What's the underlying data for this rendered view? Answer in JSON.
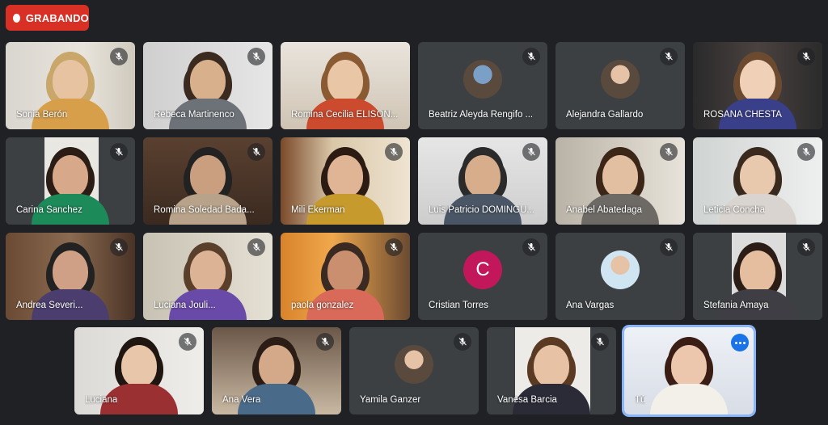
{
  "recording": {
    "label": "GRABANDO"
  },
  "colors": {
    "background": "#202124",
    "tile": "#3c4043",
    "record": "#d93025",
    "self_border": "#8ab4f8",
    "avatar_c": "#c2185b"
  },
  "participants": [
    {
      "name": "Sonia Berón",
      "type": "video",
      "muted": true
    },
    {
      "name": "Rebeca Martinenco",
      "type": "video",
      "muted": true
    },
    {
      "name": "Romina Cecilia ELISON...",
      "type": "video",
      "muted": false
    },
    {
      "name": "Beatriz Aleyda Rengifo ...",
      "type": "avatar",
      "muted": true
    },
    {
      "name": "Alejandra Gallardo",
      "type": "avatar",
      "muted": true
    },
    {
      "name": "ROSANA CHESTA",
      "type": "video",
      "muted": true
    },
    {
      "name": "Carina Sanchez",
      "type": "video",
      "muted": true
    },
    {
      "name": "Romina Soledad Bada...",
      "type": "video",
      "muted": true
    },
    {
      "name": "Mili Ekerman",
      "type": "video",
      "muted": true
    },
    {
      "name": "Luis Patricio DOMINGU...",
      "type": "video",
      "muted": true
    },
    {
      "name": "Anabel Abatedaga",
      "type": "video",
      "muted": true
    },
    {
      "name": "Leticia Concha",
      "type": "video",
      "muted": true
    },
    {
      "name": "Andrea Severi...",
      "type": "video",
      "muted": true
    },
    {
      "name": "Luciana Jouli...",
      "type": "video",
      "muted": true
    },
    {
      "name": "paola gonzalez",
      "type": "video",
      "muted": true
    },
    {
      "name": "Cristian Torres",
      "type": "letter",
      "initial": "C",
      "muted": true
    },
    {
      "name": "Ana Vargas",
      "type": "avatar",
      "muted": true
    },
    {
      "name": "Stefania Amaya",
      "type": "video",
      "muted": true
    },
    {
      "name": "Luciana",
      "type": "video",
      "muted": true
    },
    {
      "name": "Ana Vera",
      "type": "video",
      "muted": true
    },
    {
      "name": "Yamila Ganzer",
      "type": "avatar",
      "muted": true
    },
    {
      "name": "Vanesa Barcia",
      "type": "video",
      "muted": true
    },
    {
      "name": "Tú",
      "type": "video",
      "muted": false,
      "self": true
    }
  ]
}
